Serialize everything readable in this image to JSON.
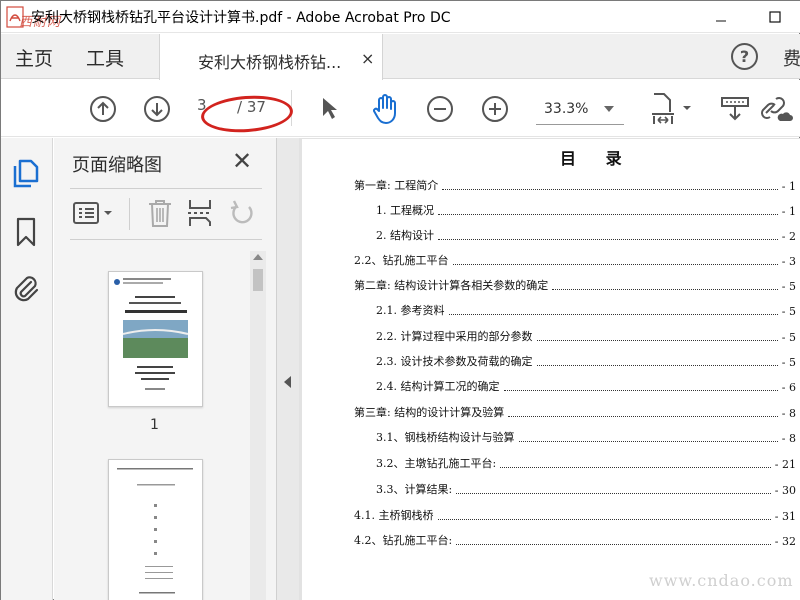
{
  "window": {
    "title": "安利大桥钢栈桥钻孔平台设计计算书.pdf - Adobe Acrobat Pro DC",
    "watermark_top": "西耐网"
  },
  "menu": {
    "home": "主页",
    "tools": "工具"
  },
  "tab": {
    "label": "安利大桥钢栈桥钻...",
    "close": "×"
  },
  "help": {
    "label": "?"
  },
  "right_clip": "费",
  "toolbar": {
    "page_current": "3",
    "page_total": "/ 37",
    "zoom": "33.3%"
  },
  "thumbnails": {
    "title": "页面缩略图",
    "close": "✕",
    "page1_number": "1"
  },
  "document": {
    "toc_title": "目 录",
    "toc": [
      {
        "label": "第一章: 工程简介",
        "page": "1"
      },
      {
        "label": "1. 工程概况",
        "page": "1"
      },
      {
        "label": "2. 结构设计",
        "page": "2"
      },
      {
        "label": "2.2、钻孔施工平台",
        "page": "3"
      },
      {
        "label": "第二章: 结构设计计算各相关参数的确定",
        "page": "5"
      },
      {
        "label": "2.1. 参考资料",
        "page": "5"
      },
      {
        "label": "2.2. 计算过程中采用的部分参数",
        "page": "5"
      },
      {
        "label": "2.3. 设计技术参数及荷载的确定",
        "page": "5"
      },
      {
        "label": "2.4. 结构计算工况的确定",
        "page": "6"
      },
      {
        "label": "第三章: 结构的设计计算及验算",
        "page": "8"
      },
      {
        "label": "3.1、钢栈桥结构设计与验算",
        "page": "8"
      },
      {
        "label": "3.2、主墩钻孔施工平台:",
        "page": "21"
      },
      {
        "label": "3.3、计算结果:",
        "page": "30"
      },
      {
        "label": "4.1. 主桥钢栈桥",
        "page": "31"
      },
      {
        "label": "4.2、钻孔施工平台:",
        "page": "32"
      }
    ]
  },
  "watermark_bottom": "www.cndao.com",
  "colors": {
    "accent_blue": "#1a6fd1",
    "annotation_red": "#d2231e"
  }
}
